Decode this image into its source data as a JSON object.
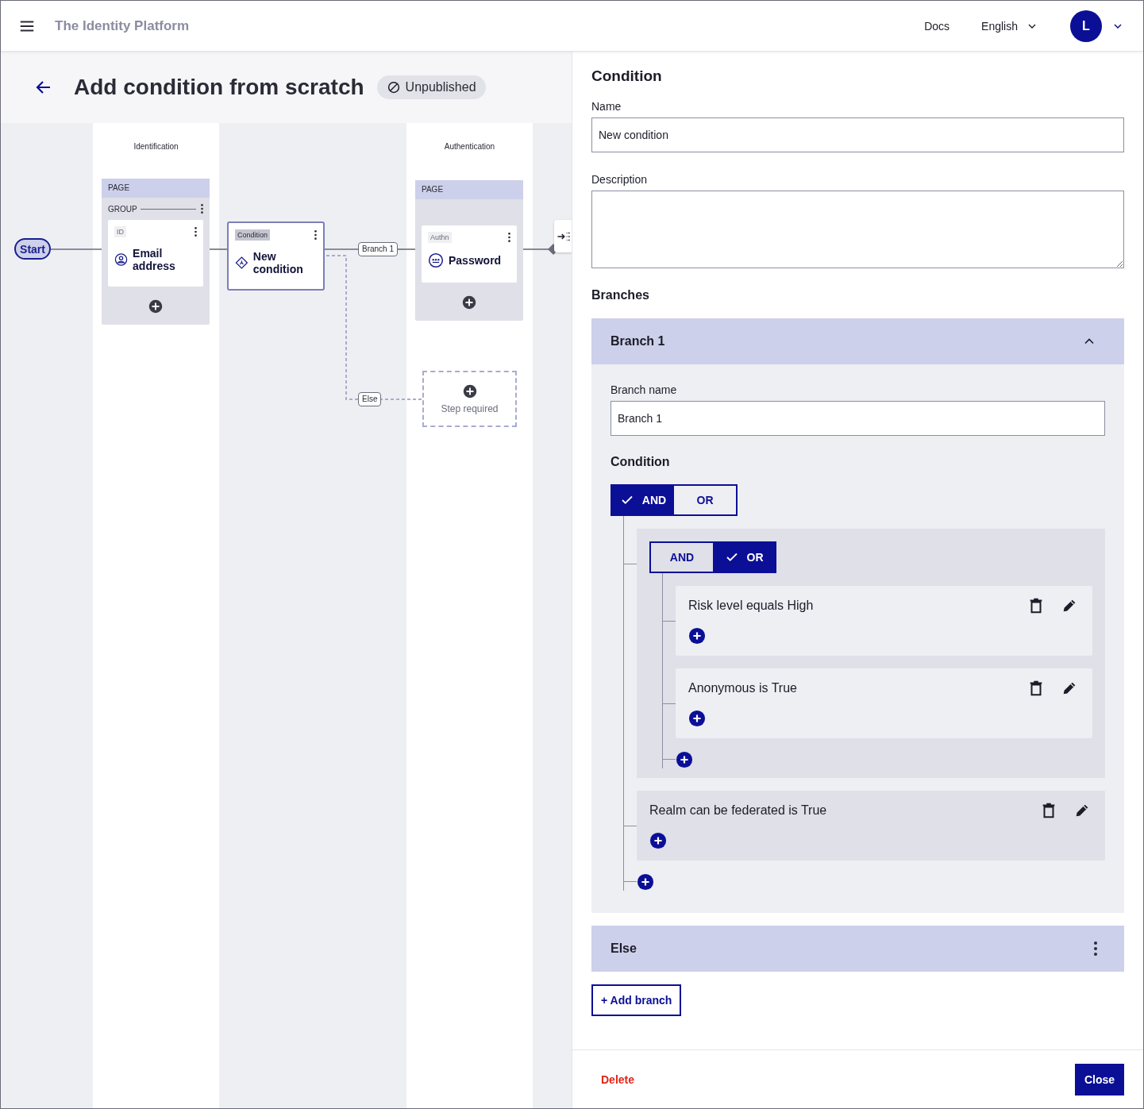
{
  "header": {
    "title": "The Identity Platform",
    "links": [
      "Docs"
    ],
    "language": "English",
    "avatar": "L"
  },
  "page": {
    "title": "Add condition from scratch",
    "status": "Unpublished"
  },
  "canvas": {
    "lanes": [
      {
        "label": "Identification"
      },
      {
        "label": "Authentication"
      }
    ],
    "start": "Start",
    "pages": [
      {
        "header": "PAGE",
        "group": "GROUP",
        "steps": [
          {
            "tag": "ID",
            "label": "Email address"
          }
        ]
      },
      {
        "header": "PAGE",
        "steps": [
          {
            "tag": "Authn",
            "label": "Password"
          }
        ]
      }
    ],
    "condition": {
      "tag": "Condition",
      "label": "New condition",
      "selected": true
    },
    "edges": [
      {
        "label": "Branch 1",
        "kind": "solid"
      },
      {
        "label": "Else",
        "kind": "dashed"
      }
    ],
    "placeholder": "Step required"
  },
  "panel": {
    "title": "Condition",
    "fields": [
      {
        "label": "Name",
        "value": "New condition",
        "kind": "input"
      },
      {
        "label": "Description",
        "kind": "textarea"
      }
    ],
    "branches_title": "Branches",
    "branches": [
      {
        "title": "Branch 1",
        "expanded": true,
        "name_label": "Branch name",
        "name_value": "Branch 1",
        "condition_title": "Condition",
        "group": {
          "operators": [
            {
              "label": "AND",
              "selected": true
            },
            {
              "label": "OR",
              "selected": false
            }
          ],
          "items": [
            {
              "kind": "group",
              "operators": [
                {
                  "label": "AND",
                  "selected": false
                },
                {
                  "label": "OR",
                  "selected": true
                }
              ],
              "items": [
                {
                  "kind": "rule",
                  "text": "Risk level equals High"
                },
                {
                  "kind": "rule",
                  "text": "Anonymous is True"
                }
              ]
            },
            {
              "kind": "rule",
              "text": "Realm can be federated is True"
            }
          ]
        }
      },
      {
        "title": "Else",
        "expanded": false
      }
    ],
    "add_branch": "+ Add branch",
    "footer": {
      "delete": "Delete",
      "close": "Close"
    }
  }
}
